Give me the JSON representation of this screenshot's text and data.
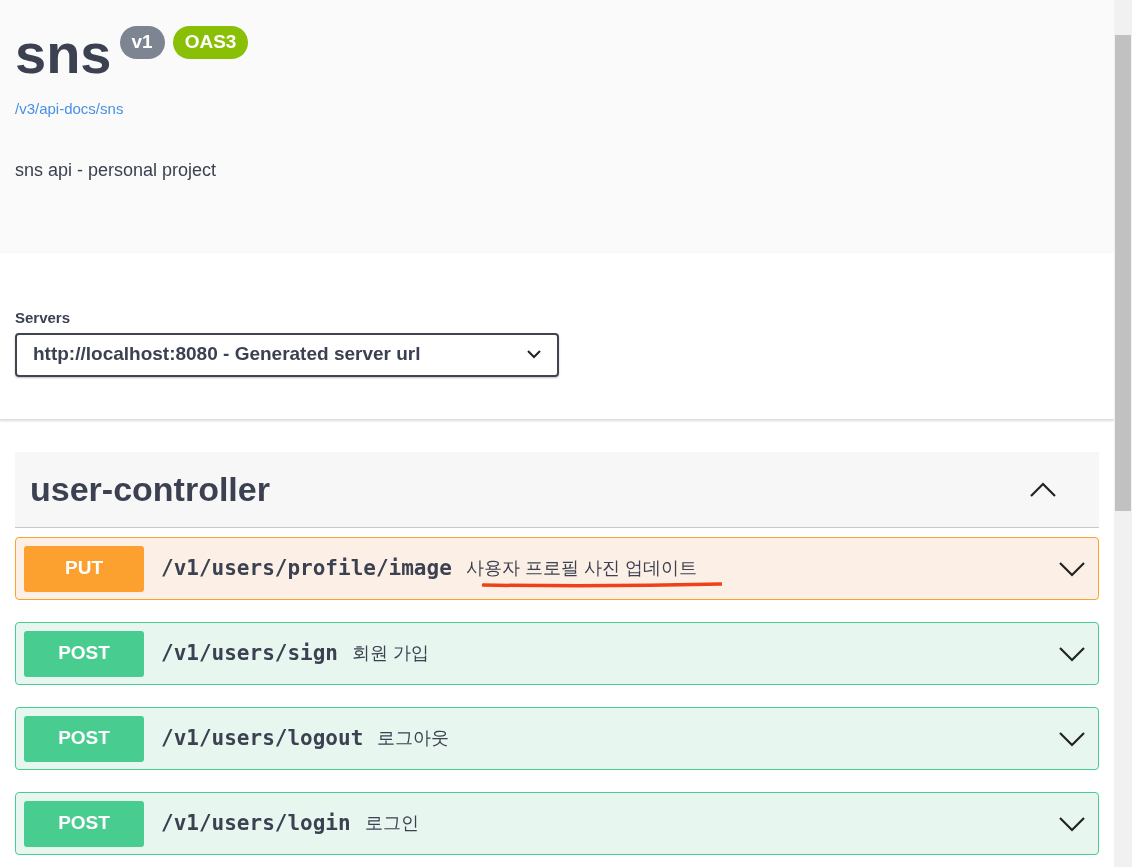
{
  "info": {
    "title": "sns",
    "version": "v1",
    "spec_badge": "OAS3",
    "spec_link": "/v3/api-docs/sns",
    "description": "sns api - personal project"
  },
  "servers": {
    "label": "Servers",
    "value": "http://localhost:8080 - Generated server url"
  },
  "tag": {
    "name": "user-controller",
    "expanded": true,
    "operations": [
      {
        "kind": "put",
        "method": "PUT",
        "path": "/v1/users/profile/image",
        "summary": "사용자 프로필 사진 업데이트",
        "underlined": true,
        "expanded": false
      },
      {
        "kind": "post",
        "method": "POST",
        "path": "/v1/users/sign",
        "summary": "회원 가입",
        "underlined": false,
        "expanded": false
      },
      {
        "kind": "post",
        "method": "POST",
        "path": "/v1/users/logout",
        "summary": "로그아웃",
        "underlined": false,
        "expanded": false
      },
      {
        "kind": "post",
        "method": "POST",
        "path": "/v1/users/login",
        "summary": "로그인",
        "underlined": false,
        "expanded": false
      }
    ]
  }
}
